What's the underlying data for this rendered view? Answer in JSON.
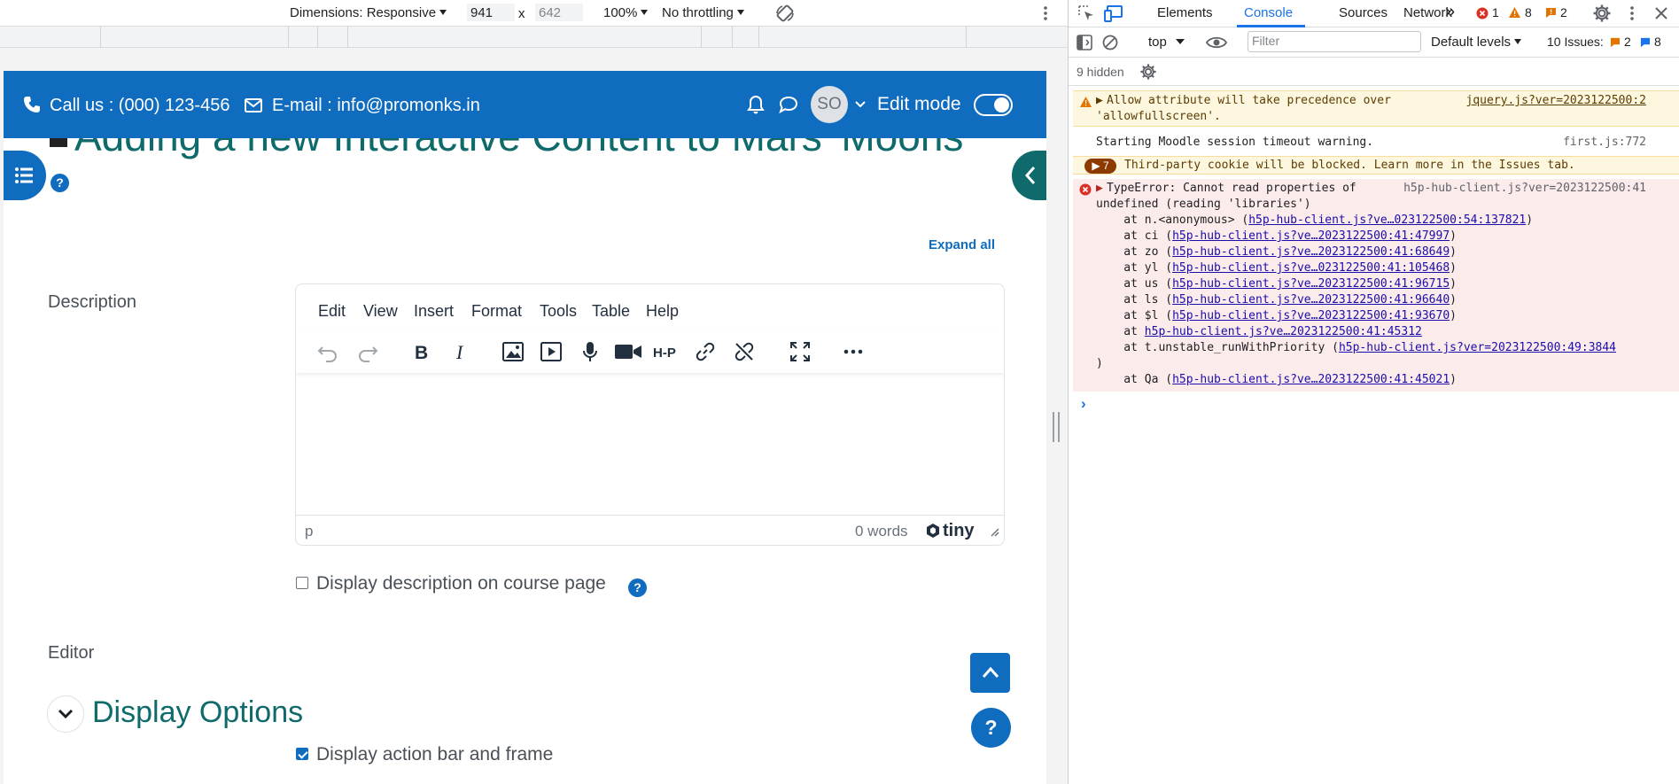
{
  "device_toolbar": {
    "dimensions": "Dimensions: Responsive",
    "width": "941",
    "times": "x",
    "height": "642",
    "zoom": "100%",
    "throttling": "No throttling"
  },
  "moodle": {
    "call_us": "Call us : (000) 123-456",
    "email": "E-mail : info@promonks.in",
    "avatar_initials": "SO",
    "edit_mode": "Edit mode",
    "page_title": "Adding a new Interactive Content to Mars' Moons",
    "help_q": "?",
    "expand_all": "Expand all",
    "description_label": "Description",
    "editor_menu": [
      "Edit",
      "View",
      "Insert",
      "Format",
      "Tools",
      "Table",
      "Help"
    ],
    "editor_status_path": "p",
    "editor_word_count": "0 words",
    "tiny_brand": "tiny",
    "display_description": "Display description on course page",
    "editor_label": "Editor",
    "display_options": "Display Options",
    "display_action_bar": "Display action bar and frame",
    "float_help": "?"
  },
  "devtools": {
    "tabs": [
      "Elements",
      "Console",
      "Sources",
      "Network"
    ],
    "active_tab": "Console",
    "more_tabs": "»",
    "error_count": "1",
    "warning_count": "8",
    "issue_count": "2",
    "context": "top",
    "filter_placeholder": "Filter",
    "default_levels": "Default levels",
    "issues_label": "10 Issues:",
    "issues_warn": "2",
    "issues_info": "8",
    "hidden": "9 hidden",
    "messages": {
      "warn1_line1": "Allow attribute will take precedence over",
      "warn1_line2": "'allowfullscreen'.",
      "warn1_src": "jquery.js?ver=2023122500:2",
      "info1": "Starting Moodle session timeout warning.",
      "info1_src": "first.js:772",
      "cookie_count": "7",
      "cookie": "Third-party cookie will be blocked. Learn more in the Issues tab.",
      "err_line1": "TypeError: Cannot read properties of",
      "err_src": "h5p-hub-client.js?ver=2023122500:41",
      "err_line2": "undefined (reading 'libraries')",
      "stack": [
        {
          "prefix": "    at n.<anonymous> (",
          "link": "h5p-hub-client.js?ve…023122500:54:137821",
          "suffix": ")"
        },
        {
          "prefix": "    at ci (",
          "link": "h5p-hub-client.js?ve…2023122500:41:47997",
          "suffix": ")"
        },
        {
          "prefix": "    at zo (",
          "link": "h5p-hub-client.js?ve…2023122500:41:68649",
          "suffix": ")"
        },
        {
          "prefix": "    at yl (",
          "link": "h5p-hub-client.js?ve…023122500:41:105468",
          "suffix": ")"
        },
        {
          "prefix": "    at us (",
          "link": "h5p-hub-client.js?ve…2023122500:41:96715",
          "suffix": ")"
        },
        {
          "prefix": "    at ls (",
          "link": "h5p-hub-client.js?ve…2023122500:41:96640",
          "suffix": ")"
        },
        {
          "prefix": "    at $l (",
          "link": "h5p-hub-client.js?ve…2023122500:41:93670",
          "suffix": ")"
        },
        {
          "prefix": "    at ",
          "link": "h5p-hub-client.js?ve…2023122500:41:45312",
          "suffix": ""
        },
        {
          "prefix": "    at t.unstable_runWithPriority (",
          "link": "h5p-hub-client.js?ver=2023122500:49:3844",
          "suffix": ""
        },
        {
          "prefix": ")",
          "link": "",
          "suffix": ""
        },
        {
          "prefix": "    at Qa (",
          "link": "h5p-hub-client.js?ve…2023122500:41:45021",
          "suffix": ")"
        }
      ]
    },
    "prompt": "›"
  },
  "colors": {
    "moodle_blue": "#0f6cbf",
    "moodle_teal": "#0f6b6b",
    "devtools_blue": "#1a73e8",
    "error_red": "#d93025",
    "warn_orange": "#e37400"
  }
}
